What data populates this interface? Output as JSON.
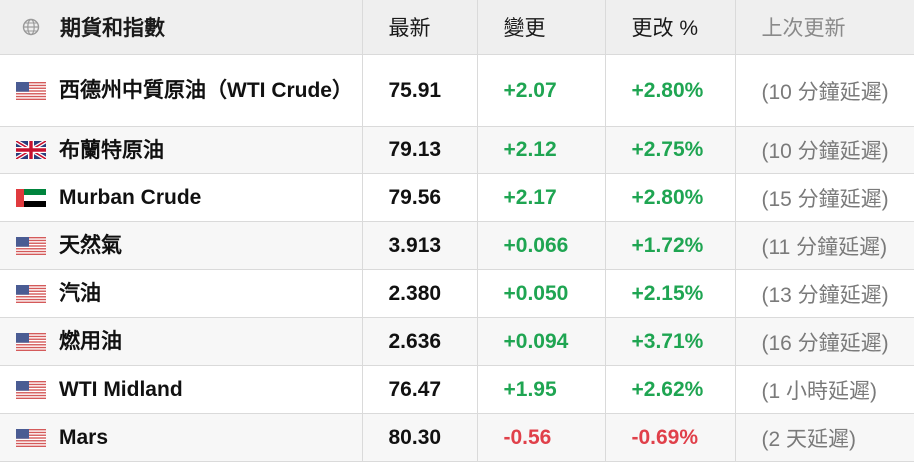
{
  "header": {
    "col_name": "期貨和指數",
    "col_last": "最新",
    "col_change": "變更",
    "col_pct": "更改 %",
    "col_updated": "上次更新",
    "icon": "globe-icon"
  },
  "colors": {
    "positive": "#1fa552",
    "negative": "#e0404a",
    "header_bg": "#efefef"
  },
  "rows": [
    {
      "flag": "us-flag-icon",
      "name": "西德州中質原油（WTI Crude）",
      "last": "75.91",
      "change": "+2.07",
      "pct": "+2.80%",
      "updated": "(10 分鐘延遲)",
      "direction": "up"
    },
    {
      "flag": "uk-flag-icon",
      "name": "布蘭特原油",
      "last": "79.13",
      "change": "+2.12",
      "pct": "+2.75%",
      "updated": "(10 分鐘延遲)",
      "direction": "up"
    },
    {
      "flag": "uae-flag-icon",
      "name": "Murban Crude",
      "last": "79.56",
      "change": "+2.17",
      "pct": "+2.80%",
      "updated": "(15 分鐘延遲)",
      "direction": "up"
    },
    {
      "flag": "us-flag-icon",
      "name": "天然氣",
      "last": "3.913",
      "change": "+0.066",
      "pct": "+1.72%",
      "updated": "(11 分鐘延遲)",
      "direction": "up"
    },
    {
      "flag": "us-flag-icon",
      "name": "汽油",
      "last": "2.380",
      "change": "+0.050",
      "pct": "+2.15%",
      "updated": "(13 分鐘延遲)",
      "direction": "up"
    },
    {
      "flag": "us-flag-icon",
      "name": "燃用油",
      "last": "2.636",
      "change": "+0.094",
      "pct": "+3.71%",
      "updated": "(16 分鐘延遲)",
      "direction": "up"
    },
    {
      "flag": "us-flag-icon",
      "name": "WTI Midland",
      "last": "76.47",
      "change": "+1.95",
      "pct": "+2.62%",
      "updated": "(1 小時延遲)",
      "direction": "up"
    },
    {
      "flag": "us-flag-icon",
      "name": "Mars",
      "last": "80.30",
      "change": "-0.56",
      "pct": "-0.69%",
      "updated": "(2 天延遲)",
      "direction": "down"
    }
  ]
}
